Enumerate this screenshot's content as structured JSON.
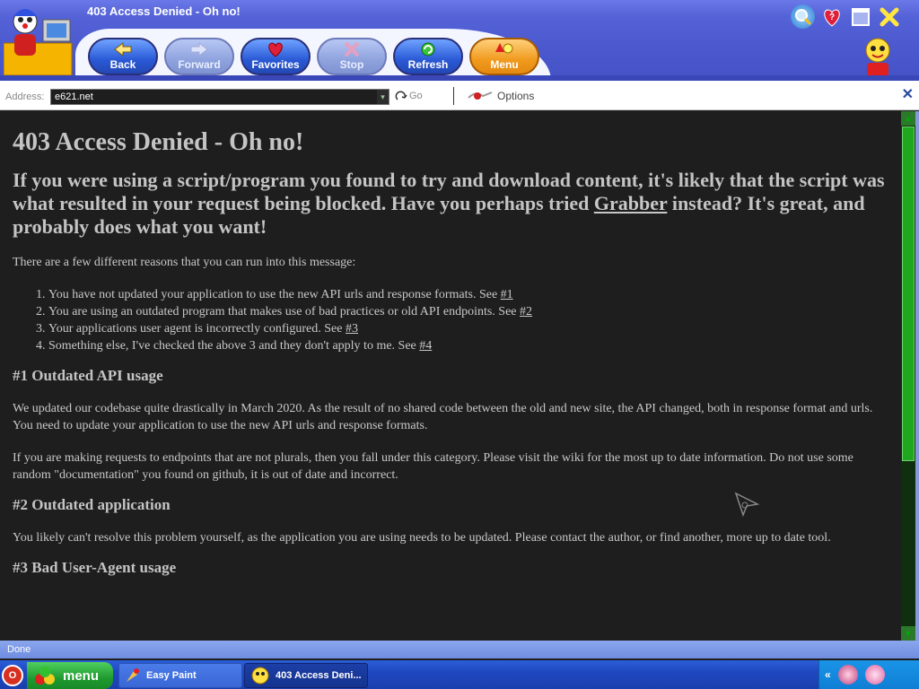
{
  "window": {
    "title": "403 Access Denied - Oh no!"
  },
  "toolbar": {
    "buttons": [
      {
        "label": "Back"
      },
      {
        "label": "Forward"
      },
      {
        "label": "Favorites"
      },
      {
        "label": "Stop"
      },
      {
        "label": "Refresh"
      },
      {
        "label": "Menu"
      }
    ]
  },
  "address": {
    "label": "Address:",
    "value": "e621.net",
    "go_label": "Go",
    "options_label": "Options"
  },
  "page": {
    "heading": "403 Access Denied - Oh no!",
    "subheading_before": "If you were using a script/program you found to try and download content, it's likely that the script was what resulted in your request being blocked. Have you perhaps tried ",
    "subheading_link": "Grabber",
    "subheading_after": " instead? It's great, and probably does what you want!",
    "intro": "There are a few different reasons that you can run into this message:",
    "reasons": [
      {
        "text": "You have not updated your application to use the new API urls and response formats. See ",
        "link": "#1"
      },
      {
        "text": "You are using an outdated program that makes use of bad practices or old API endpoints. See ",
        "link": "#2"
      },
      {
        "text": "Your applications user agent is incorrectly configured. See ",
        "link": "#3"
      },
      {
        "text": "Something else, I've checked the above 3 and they don't apply to me. See ",
        "link": "#4"
      }
    ],
    "sections": [
      {
        "title": "#1 Outdated API usage",
        "paragraphs": [
          "We updated our codebase quite drastically in March 2020. As the result of no shared code between the old and new site, the API changed, both in response format and urls. You need to update your application to use the new API urls and response formats.",
          "If you are making requests to endpoints that are not plurals, then you fall under this category. Please visit the wiki for the most up to date information. Do not use some random \"documentation\" you found on github, it is out of date and incorrect."
        ]
      },
      {
        "title": "#2 Outdated application",
        "paragraphs": [
          "You likely can't resolve this problem yourself, as the application you are using needs to be updated. Please contact the author, or find another, more up to date tool."
        ]
      },
      {
        "title": "#3 Bad User-Agent usage",
        "paragraphs": []
      }
    ]
  },
  "status": {
    "text": "Done"
  },
  "taskbar": {
    "menu_label": "menu",
    "tasks": [
      {
        "label": "Easy Paint"
      },
      {
        "label": "403 Access Deni..."
      }
    ]
  },
  "colors": {
    "page_bg": "#1e1e1e",
    "text": "#c8c8c8",
    "titlebar": "#5563d8",
    "taskbar": "#1f48c0",
    "scroll_thumb": "#1fa81f"
  }
}
